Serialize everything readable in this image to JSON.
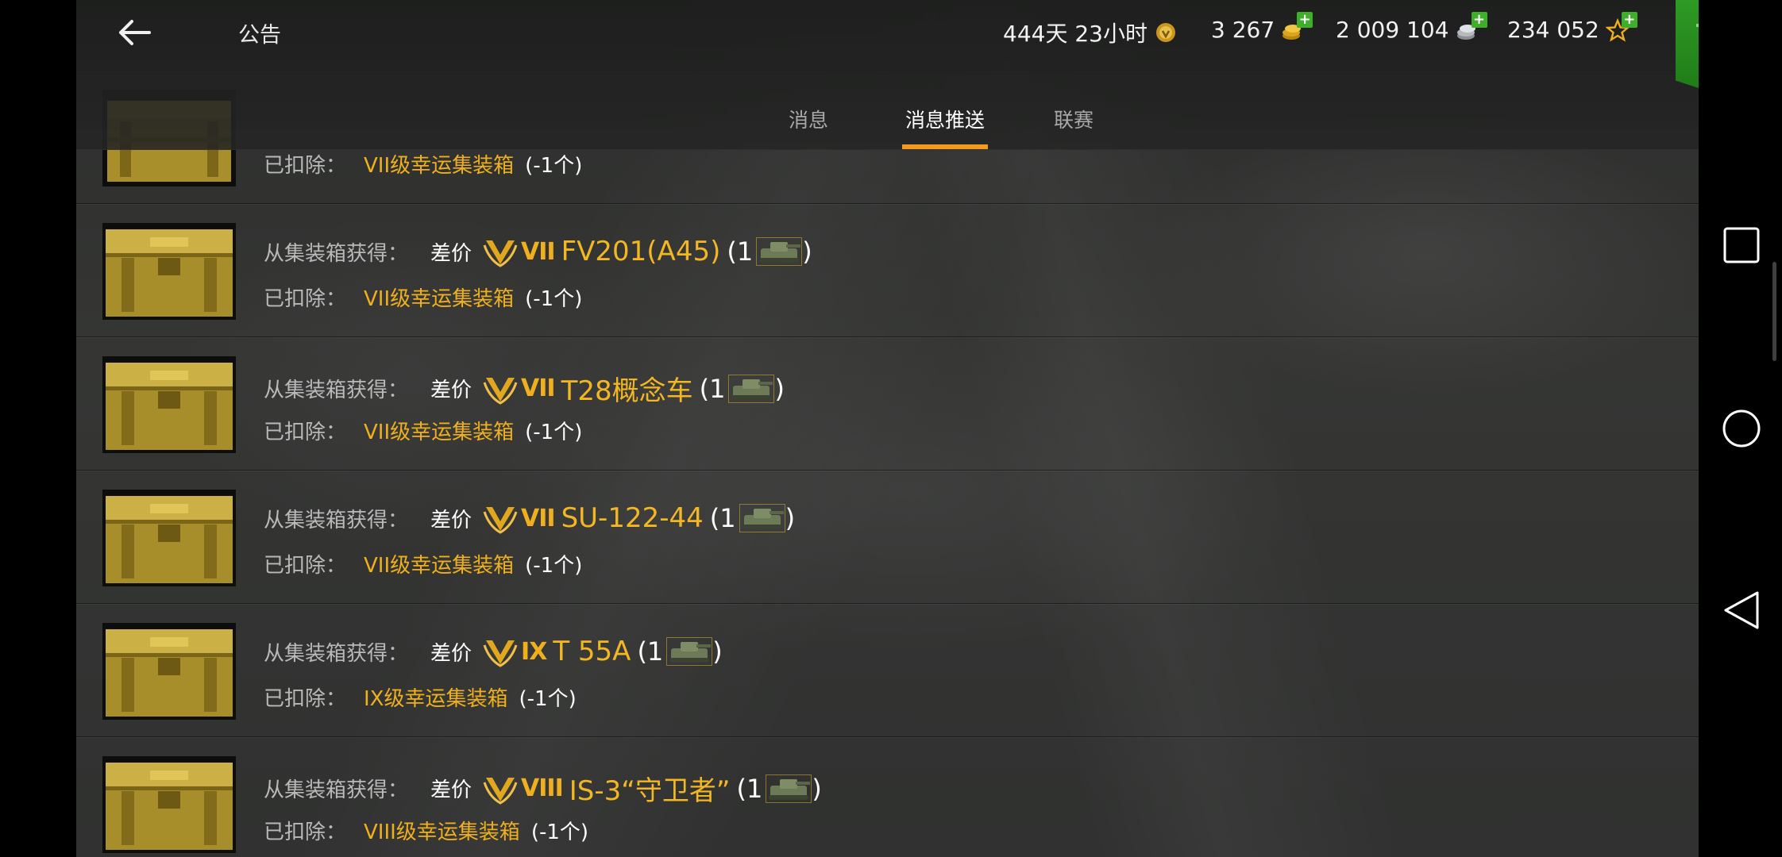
{
  "header": {
    "back_label": "",
    "title": "公告",
    "premium_time": "444天 23小时",
    "gold": "3 267",
    "silver": "2 009 104",
    "free_xp": "234 052",
    "icons": [
      "back-arrow-icon",
      "premium-badge-icon",
      "gold-coins-icon",
      "silver-coins-icon",
      "star-xp-icon",
      "shopping-cart-icon"
    ]
  },
  "tabs": [
    {
      "label": "消息",
      "active": false
    },
    {
      "label": "消息推送",
      "active": true
    },
    {
      "label": "联赛",
      "active": false
    }
  ],
  "rows": [
    {
      "partial": true,
      "label_deducted": "已扣除：",
      "deducted_item": "VII级幸运集装箱",
      "deducted_qty": "(-1个)"
    },
    {
      "label_gain": "从集装箱获得：",
      "gain_type": "差价",
      "tier": "VII",
      "tank": "FV201(A45)",
      "qty_open": "(1",
      "qty_close": ")",
      "label_deducted": "已扣除：",
      "deducted_item": "VII级幸运集装箱",
      "deducted_qty": "(-1个)"
    },
    {
      "label_gain": "从集装箱获得：",
      "gain_type": "差价",
      "tier": "VII",
      "tank": "T28概念车",
      "qty_open": "(1",
      "qty_close": ")",
      "label_deducted": "已扣除：",
      "deducted_item": "VII级幸运集装箱",
      "deducted_qty": "(-1个)"
    },
    {
      "label_gain": "从集装箱获得：",
      "gain_type": "差价",
      "tier": "VII",
      "tank": "SU-122-44",
      "qty_open": "(1",
      "qty_close": ")",
      "label_deducted": "已扣除：",
      "deducted_item": "VII级幸运集装箱",
      "deducted_qty": "(-1个)"
    },
    {
      "label_gain": "从集装箱获得：",
      "gain_type": "差价",
      "tier": "IX",
      "tank": "T 55A",
      "qty_open": "(1",
      "qty_close": ")",
      "label_deducted": "已扣除：",
      "deducted_item": "IX级幸运集装箱",
      "deducted_qty": "(-1个)"
    },
    {
      "label_gain": "从集装箱获得：",
      "gain_type": "差价",
      "tier": "VIII",
      "tank": "IS-3“守卫者”",
      "qty_open": "(1",
      "qty_close": ")",
      "label_deducted": "已扣除：",
      "deducted_item": "VIII级幸运集装箱",
      "deducted_qty": "(-1个)"
    }
  ],
  "system_nav": [
    "recents-square-icon",
    "home-circle-icon",
    "back-triangle-icon"
  ]
}
